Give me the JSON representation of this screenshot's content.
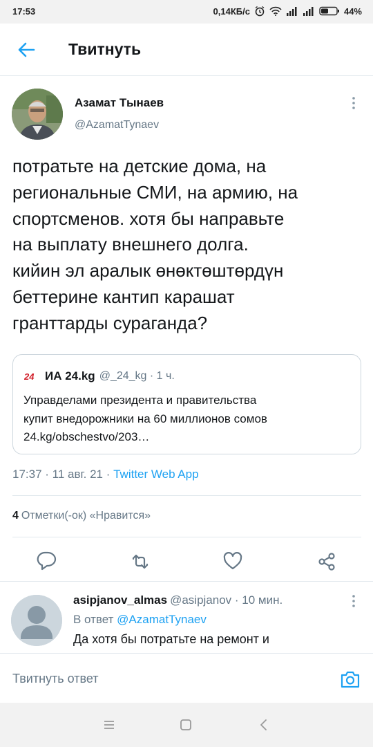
{
  "status_bar": {
    "time": "17:53",
    "speed": "0,14КБ/с",
    "battery": "44%"
  },
  "header": {
    "title": "Твитнуть",
    "back_icon": "arrow-left-icon"
  },
  "tweet": {
    "author_name": "Азамат Тынаев",
    "author_handle": "@AzamatTynaev",
    "lines": [
      "потратьте на детские дома, на",
      "региональные СМИ, на армию, на",
      "спортсменов. хотя бы направьте",
      "на выплату внешнего долга.",
      "кийин эл аралык өнөктөштөрдүн",
      "беттерине кантип карашат",
      "гранттарды сураганда?"
    ],
    "quote": {
      "logo_text": "24",
      "name": "ИА 24.kg",
      "handle_time": "@_24_kg · 1 ч.",
      "lines": [
        "Управделами президента и правительства",
        "купит внедорожники на 60 миллионов сомов",
        "24.kg/obschestvo/203…"
      ]
    },
    "timestamp": "17:37 · 11 авг. 21 · ",
    "via": "Twitter Web App",
    "likes_count": "4",
    "likes_label": "Отметки(-ок) «Нравится»",
    "action_icons": [
      "reply-icon",
      "retweet-icon",
      "like-icon",
      "share-icon"
    ]
  },
  "reply": {
    "name": "asipjanov_almas",
    "handle_time": "@asipjanov · 10 мин.",
    "reply_to_prefix": "В ответ ",
    "reply_to_handle": "@AzamatTynaev",
    "text": "Да хотя бы потратьте на ремонт и"
  },
  "compose": {
    "placeholder": "Твитнуть ответ",
    "camera_icon": "camera-icon"
  },
  "colors": {
    "accent": "#1da1f2",
    "secondary_text": "#657786",
    "primary_text": "#14171a",
    "border": "#e1e8ed"
  }
}
